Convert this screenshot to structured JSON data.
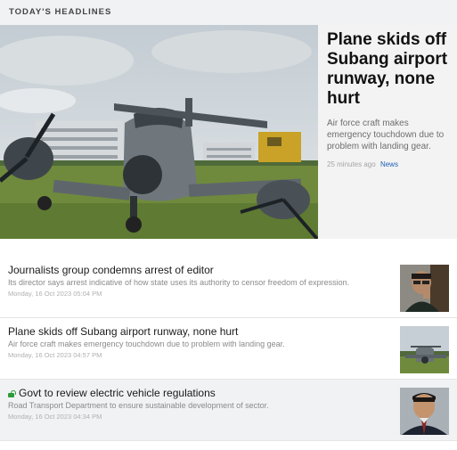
{
  "section": {
    "title": "TODAY'S HEADLINES"
  },
  "featured": {
    "title": "Plane skids off Subang airport runway, none hurt",
    "summary": "Air force craft makes emergency touchdown due to problem with landing gear.",
    "time": "25 minutes ago",
    "tag": "News",
    "image_icon": "plane-on-grass-photo"
  },
  "articles": [
    {
      "headline": "Journalists group condemns arrest of editor",
      "summary": "Its director says arrest indicative of how state uses its authority to censor freedom of expression.",
      "date": "Monday, 16 Oct 2023 05:04 PM",
      "thumbnail": "man-glasses-photo",
      "locked": false
    },
    {
      "headline": "Plane skids off Subang airport runway, none hurt",
      "summary": "Air force craft makes emergency touchdown due to problem with landing gear.",
      "date": "Monday, 16 Oct 2023 04:57 PM",
      "thumbnail": "plane-photo",
      "locked": false
    },
    {
      "headline": "Govt to review electric vehicle regulations",
      "summary": "Road Transport Department to ensure sustainable development of sector.",
      "date": "Monday, 16 Oct 2023 04:34 PM",
      "thumbnail": "minister-photo",
      "locked": true,
      "lock_icon": "open-lock-icon",
      "lock_color": "#2e9a3a"
    }
  ]
}
